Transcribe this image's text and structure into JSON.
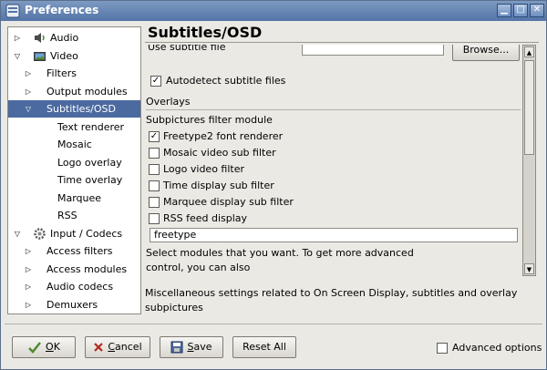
{
  "window": {
    "title": "Preferences",
    "minimize": "▁",
    "maximize": "□",
    "close": "✕"
  },
  "tree": {
    "items": [
      {
        "label": "Audio",
        "level": 1,
        "expander": "right",
        "icon": "speaker-icon"
      },
      {
        "label": "Video",
        "level": 1,
        "expander": "down",
        "icon": "video-icon"
      },
      {
        "label": "Filters",
        "level": 2,
        "expander": "right"
      },
      {
        "label": "Output modules",
        "level": 2,
        "expander": "right"
      },
      {
        "label": "Subtitles/OSD",
        "level": 2,
        "expander": "down",
        "selected": true
      },
      {
        "label": "Text renderer",
        "level": 3
      },
      {
        "label": "Mosaic",
        "level": 3
      },
      {
        "label": "Logo overlay",
        "level": 3
      },
      {
        "label": "Time overlay",
        "level": 3
      },
      {
        "label": "Marquee",
        "level": 3
      },
      {
        "label": "RSS",
        "level": 3
      },
      {
        "label": "Input / Codecs",
        "level": 1,
        "expander": "down",
        "icon": "codecs-icon"
      },
      {
        "label": "Access filters",
        "level": 2,
        "expander": "right"
      },
      {
        "label": "Access modules",
        "level": 2,
        "expander": "right"
      },
      {
        "label": "Audio codecs",
        "level": 2,
        "expander": "right"
      },
      {
        "label": "Demuxers",
        "level": 2,
        "expander": "right"
      }
    ]
  },
  "panel": {
    "title": "Subtitles/OSD",
    "subtitle_file_label": "Use subtitle file",
    "subtitle_file_value": "",
    "browse_label": "Browse...",
    "autodetect_label": "Autodetect subtitle files",
    "autodetect_checked": true,
    "overlays_label": "Overlays",
    "filter_module_label": "Subpictures filter module",
    "filters": [
      {
        "label": "Freetype2 font renderer",
        "checked": true
      },
      {
        "label": "Mosaic video sub filter",
        "checked": false
      },
      {
        "label": "Logo video filter",
        "checked": false
      },
      {
        "label": "Time display sub filter",
        "checked": false
      },
      {
        "label": "Marquee display sub filter",
        "checked": false
      },
      {
        "label": "RSS feed display",
        "checked": false
      }
    ],
    "module_value": "freetype",
    "help_line1": "Select modules that you want. To get more advanced",
    "help_line2": "control, you can also"
  },
  "description": "Miscellaneous settings related to On Screen Display, subtitles and overlay subpictures",
  "buttons": {
    "ok": {
      "pre": "",
      "u": "O",
      "post": "K"
    },
    "cancel": {
      "pre": "",
      "u": "C",
      "post": "ancel"
    },
    "save": {
      "pre": "",
      "u": "S",
      "post": "ave"
    },
    "reset": "Reset All"
  },
  "advanced_options": {
    "label": "Advanced options",
    "checked": false
  }
}
